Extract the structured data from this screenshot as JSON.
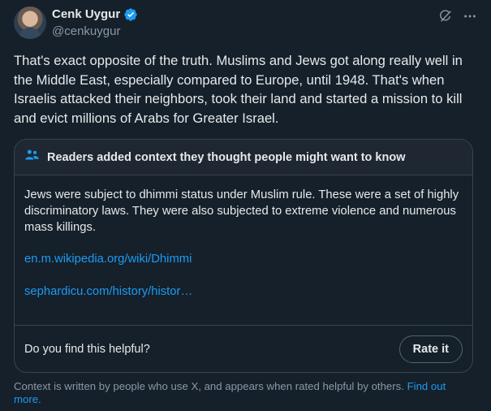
{
  "author": {
    "display_name": "Cenk Uygur",
    "handle": "@cenkuygur",
    "verified": true
  },
  "tweet": {
    "text": "That's exact opposite of the truth. Muslims and Jews got along really well in the Middle East, especially compared to Europe, until 1948. That's when Israelis attacked their neighbors, took their land and started a mission to kill and evict millions of Arabs for Greater Israel."
  },
  "community_note": {
    "header": "Readers added context they thought people might want to know",
    "body": "Jews were subject to dhimmi status under Muslim rule. These were a set of highly discriminatory laws. They were also subjected to extreme violence and numerous mass killings.",
    "links": [
      "en.m.wikipedia.org/wiki/Dhimmi",
      "sephardicu.com/history/histor…"
    ],
    "helpful_question": "Do you find this helpful?",
    "rate_button": "Rate it"
  },
  "footer": {
    "text": "Context is written by people who use X, and appears when rated helpful by others.",
    "link": "Find out more."
  },
  "colors": {
    "background": "#15202b",
    "accent": "#1d9bf0",
    "secondary_text": "#8b98a5"
  },
  "icons": [
    "verified-badge-icon",
    "grok-icon",
    "more-options-icon",
    "people-icon"
  ]
}
